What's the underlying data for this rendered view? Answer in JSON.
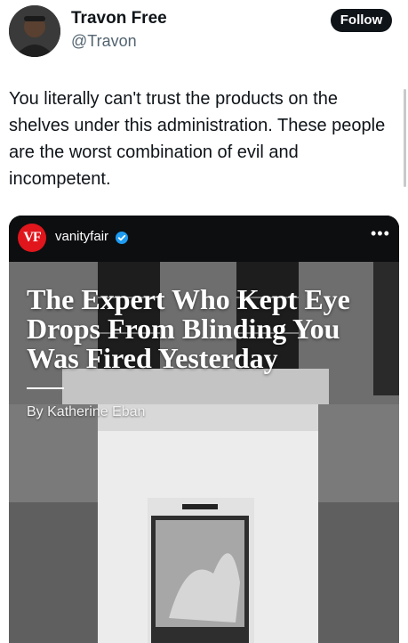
{
  "author": {
    "display_name": "Travon Free",
    "handle": "@Travon",
    "follow_label": "Follow"
  },
  "tweet": {
    "text": "You literally can't trust the products on the shelves under this administration. These people are the worst combination of evil and incompetent."
  },
  "embed": {
    "account_name": "vanityfair",
    "logo_text": "VF",
    "more_label": "•••",
    "headline": "The Expert Who Kept Eye Drops From Blinding You Was Fired Yesterday",
    "byline": "By Katherine Eban"
  },
  "colors": {
    "follow_bg": "#0f1419",
    "vf_red": "#e0161c",
    "verified_blue": "#1d9bf0"
  },
  "icons": {
    "verified": "verified-badge-icon",
    "more": "more-options-icon"
  }
}
